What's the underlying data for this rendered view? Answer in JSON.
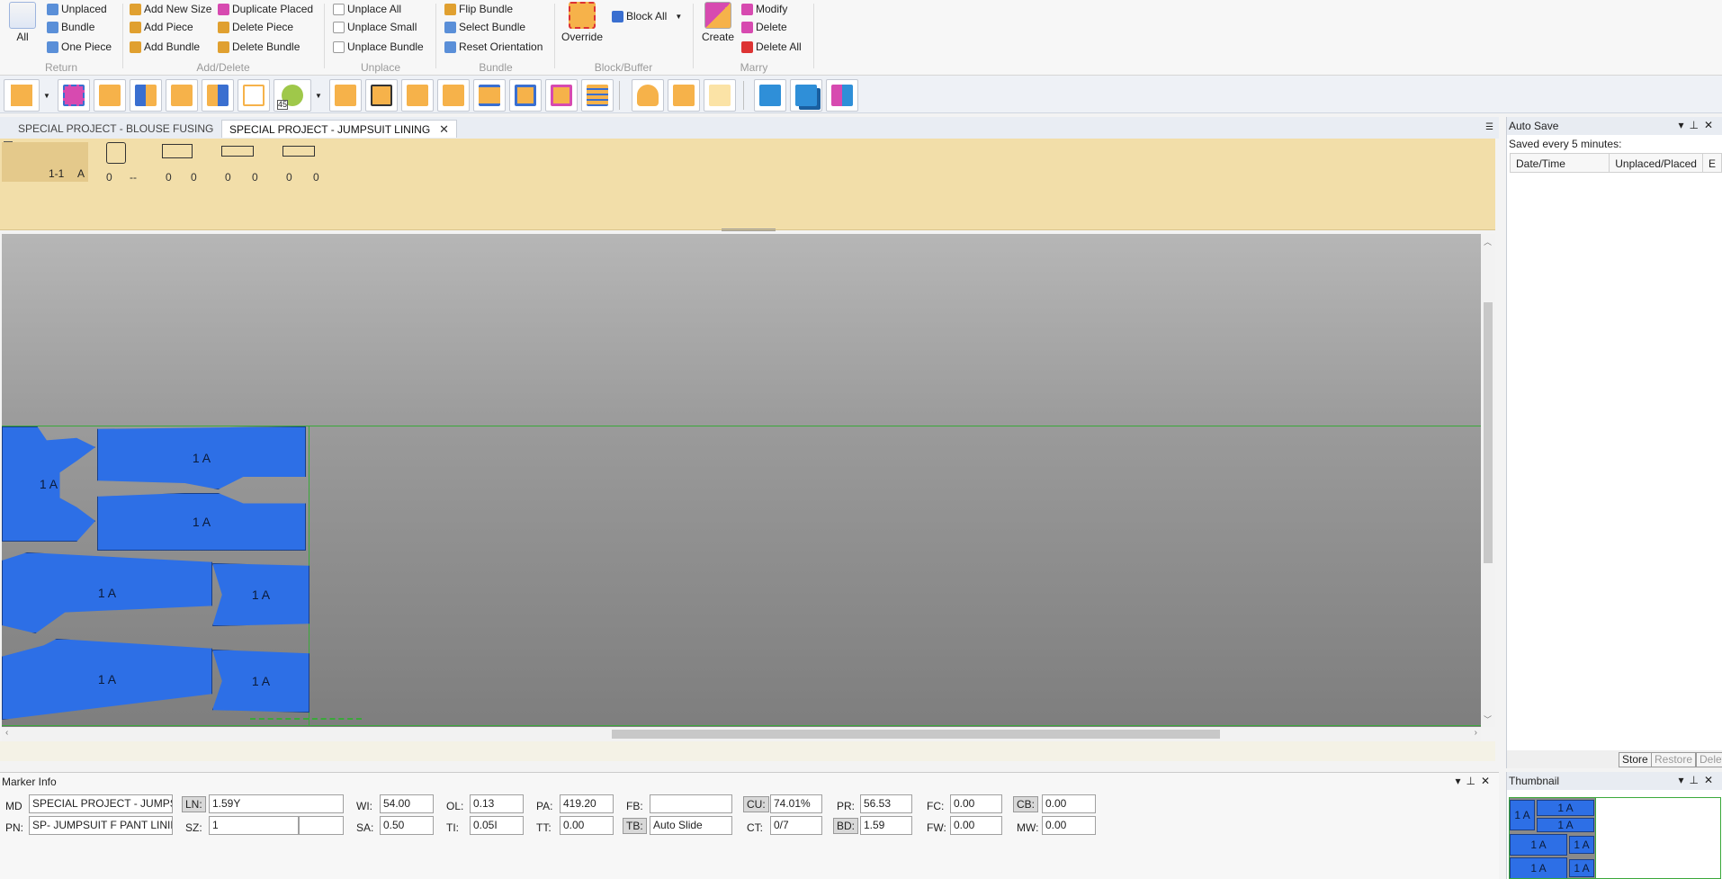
{
  "ribbon": {
    "return": {
      "all": "All",
      "unplaced": "Unplaced",
      "bundle": "Bundle",
      "one_piece": "One Piece",
      "group_label": "Return"
    },
    "add_delete": {
      "add_new_size": "Add New Size",
      "add_piece": "Add Piece",
      "add_bundle": "Add Bundle",
      "duplicate_placed": "Duplicate Placed",
      "delete_piece": "Delete Piece",
      "delete_bundle": "Delete Bundle",
      "group_label": "Add/Delete"
    },
    "unplace": {
      "unplace_all": "Unplace All",
      "unplace_small": "Unplace Small",
      "unplace_bundle": "Unplace Bundle",
      "group_label": "Unplace"
    },
    "bundle": {
      "flip_bundle": "Flip Bundle",
      "select_bundle": "Select Bundle",
      "reset_orientation": "Reset Orientation",
      "group_label": "Bundle"
    },
    "block_buffer": {
      "override": "Override",
      "block_all": "Block All",
      "group_label": "Block/Buffer"
    },
    "marry": {
      "create": "Create",
      "modify": "Modify",
      "delete": "Delete",
      "delete_all": "Delete All",
      "group_label": "Marry"
    }
  },
  "toolbar": {
    "rotate_value": "45",
    "icons": [
      "swap-horizontal-icon",
      "select-pieces-icon",
      "move-left-icon",
      "ruler-icon",
      "slide-left-icon",
      "bar-chart-icon",
      "flip-icon",
      "rotate-icon",
      "copy-piece-icon",
      "buffer-icon",
      "scissors-icon",
      "fold-icon",
      "align-top-icon",
      "diamond-icon",
      "overlap-icon",
      "grid-icon",
      "bucket-icon",
      "warning-icon",
      "warning-outline-icon",
      "view-single-icon",
      "view-overlap-icon",
      "view-split-icon"
    ]
  },
  "tabs": [
    {
      "label": "SPECIAL PROJECT - BLOUSE FUSING",
      "active": false
    },
    {
      "label": "SPECIAL PROJECT - JUMPSUIT LINING",
      "active": true
    }
  ],
  "strip": {
    "size_label": "1-1",
    "size_code": "A",
    "pieces": [
      {
        "a": "0",
        "b": "--"
      },
      {
        "a": "0",
        "b": "0"
      },
      {
        "a": "0",
        "b": "0"
      },
      {
        "a": "0",
        "b": "0"
      }
    ]
  },
  "marker": {
    "piece_label": "1 A"
  },
  "autosave": {
    "title": "Auto Save",
    "saved_text": "Saved every 5 minutes:",
    "col_datetime": "Date/Time",
    "col_unplaced": "Unplaced/Placed",
    "col_extra": "E",
    "store": "Store",
    "restore": "Restore",
    "delete": "Delete"
  },
  "marker_info": {
    "title": "Marker Info",
    "md_label": "MD",
    "md_value": "SPECIAL PROJECT - JUMPSUIT",
    "pn_label": "PN:",
    "pn_value": "SP- JUMPSUIT F PANT LINING",
    "ln_label": "LN:",
    "ln_value": "1.59Y",
    "sz_label": "SZ:",
    "sz_value": "1",
    "wi_label": "WI:",
    "wi_value": "54.00",
    "sa_label": "SA:",
    "sa_value": "0.50",
    "ol_label": "OL:",
    "ol_value": "0.13",
    "ti_label": "TI:",
    "ti_value": "0.05I",
    "pa_label": "PA:",
    "pa_value": "419.20",
    "tt_label": "TT:",
    "tt_value": "0.00",
    "fb_label": "FB:",
    "fb_value": "",
    "tb_label": "TB:",
    "tb_value": "Auto Slide",
    "cu_label": "CU:",
    "cu_value": "74.01%",
    "ct_label": "CT:",
    "ct_value": "0/7",
    "pr_label": "PR:",
    "pr_value": "56.53",
    "bd_label": "BD:",
    "bd_value": "1.59",
    "fc_label": "FC:",
    "fc_value": "0.00",
    "fw_label": "FW:",
    "fw_value": "0.00",
    "cb_label": "CB:",
    "cb_value": "0.00",
    "mw_label": "MW:",
    "mw_value": "0.00"
  },
  "thumbnail": {
    "title": "Thumbnail",
    "piece_label": "1 A"
  },
  "colors": {
    "piece_blue": "#2d6fe6",
    "marker_border_green": "#3aa83a",
    "strip_bg": "#f2dea9"
  }
}
